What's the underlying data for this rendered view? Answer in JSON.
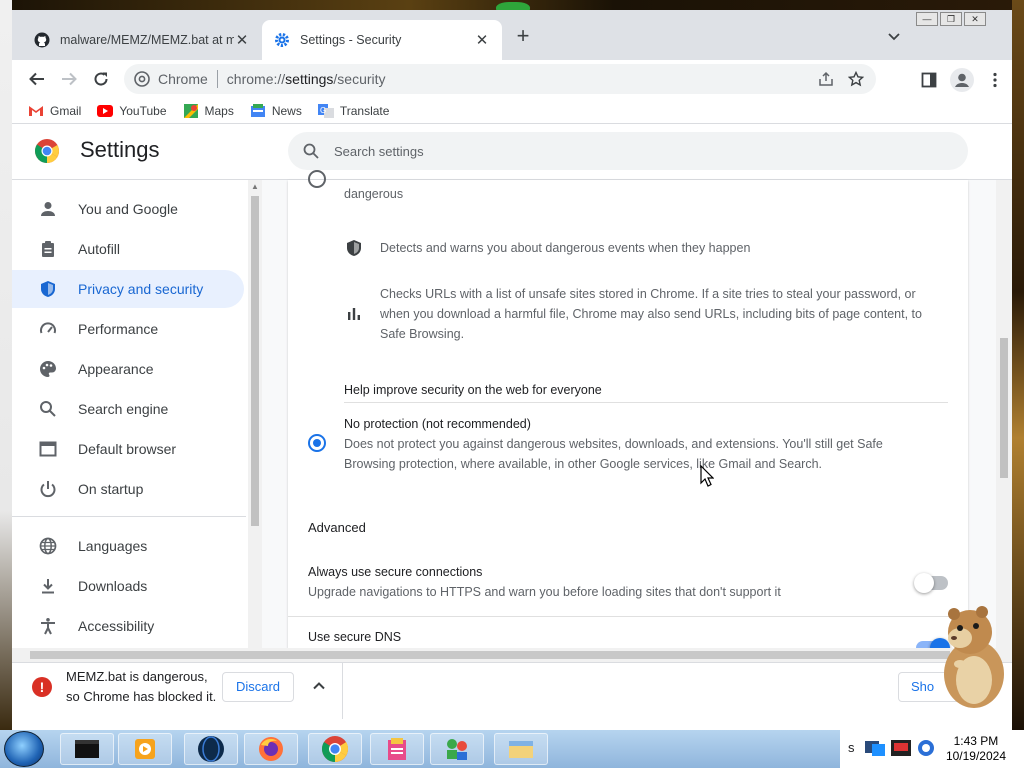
{
  "browser": {
    "tabs": [
      {
        "title": "malware/MEMZ/MEMZ.bat at m",
        "icon": "github-icon",
        "active": false
      },
      {
        "title": "Settings - Security",
        "icon": "gear-icon",
        "active": true
      }
    ],
    "new_tab": "+",
    "omnibox": {
      "origin": "Chrome",
      "url_prefix": "chrome://",
      "url_host": "settings",
      "url_path": "/security"
    }
  },
  "bookmarks": [
    {
      "label": "Gmail",
      "icon": "gmail-icon",
      "color": "#ea4335"
    },
    {
      "label": "YouTube",
      "icon": "youtube-icon",
      "color": "#ff0000"
    },
    {
      "label": "Maps",
      "icon": "maps-icon",
      "color": "#34a853"
    },
    {
      "label": "News",
      "icon": "news-icon",
      "color": "#4285f4"
    },
    {
      "label": "Translate",
      "icon": "translate-icon",
      "color": "#4285f4"
    }
  ],
  "settings": {
    "title": "Settings",
    "search_placeholder": "Search settings",
    "nav": [
      {
        "label": "You and Google",
        "icon": "person-icon"
      },
      {
        "label": "Autofill",
        "icon": "clipboard-icon"
      },
      {
        "label": "Privacy and security",
        "icon": "shield-icon",
        "selected": true
      },
      {
        "label": "Performance",
        "icon": "speedometer-icon"
      },
      {
        "label": "Appearance",
        "icon": "palette-icon"
      },
      {
        "label": "Search engine",
        "icon": "search-icon"
      },
      {
        "label": "Default browser",
        "icon": "browser-icon"
      },
      {
        "label": "On startup",
        "icon": "power-icon"
      },
      {
        "label": "Languages",
        "icon": "globe-icon"
      },
      {
        "label": "Downloads",
        "icon": "download-icon"
      },
      {
        "label": "Accessibility",
        "icon": "accessibility-icon"
      }
    ],
    "content": {
      "partial_text": "dangerous",
      "detail_1": "Detects and warns you about dangerous events when they happen",
      "detail_2_line1": "Checks URLs with a list of unsafe sites stored in Chrome. If a site tries to steal your password, or",
      "detail_2_line2": "when you download a harmful file, Chrome may also send URLs, including bits of page content, to",
      "detail_2_line3": "Safe Browsing.",
      "help_improve": "Help improve security on the web for everyone",
      "no_protection_title": "No protection (not recommended)",
      "no_protection_line1": "Does not protect you against dangerous websites, downloads, and extensions. You'll still get Safe",
      "no_protection_line2": "Browsing protection, where available, in other Google services, like Gmail and Search.",
      "advanced_heading": "Advanced",
      "secure_conn_title": "Always use secure connections",
      "secure_conn_desc": "Upgrade navigations to HTTPS and warn you before loading sites that don't support it",
      "secure_conn_enabled": false,
      "secure_dns_title": "Use secure DNS",
      "secure_dns_enabled": true
    }
  },
  "download_bar": {
    "message_line1": "MEMZ.bat is dangerous,",
    "message_line2": "so Chrome has blocked it.",
    "discard_label": "Discard",
    "show_all_label": "Sho"
  },
  "taskbar": {
    "time": "1:43 PM",
    "date": "10/19/2024",
    "partial_label": "s"
  }
}
